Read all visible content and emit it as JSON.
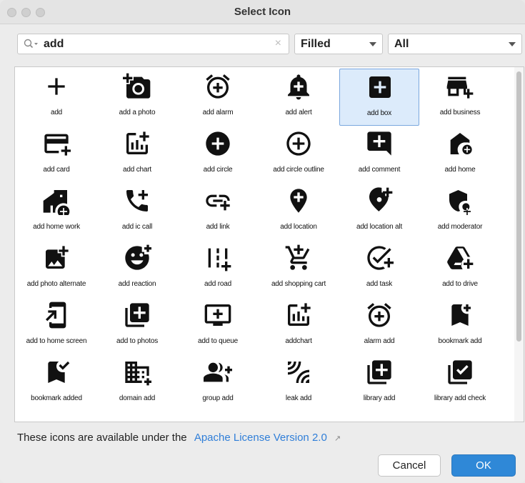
{
  "window": {
    "title": "Select Icon"
  },
  "search": {
    "value": "add",
    "clear_glyph": "×"
  },
  "filters": {
    "style_selected": "Filled",
    "category_selected": "All"
  },
  "icons": [
    {
      "label": "add",
      "icon": "add-icon"
    },
    {
      "label": "add a photo",
      "icon": "add-a-photo-icon"
    },
    {
      "label": "add alarm",
      "icon": "add-alarm-icon"
    },
    {
      "label": "add alert",
      "icon": "add-alert-icon"
    },
    {
      "label": "add box",
      "icon": "add-box-icon",
      "selected": true
    },
    {
      "label": "add business",
      "icon": "add-business-icon"
    },
    {
      "label": "add card",
      "icon": "add-card-icon"
    },
    {
      "label": "add chart",
      "icon": "add-chart-icon"
    },
    {
      "label": "add circle",
      "icon": "add-circle-icon"
    },
    {
      "label": "add circle outline",
      "icon": "add-circle-outline-icon"
    },
    {
      "label": "add comment",
      "icon": "add-comment-icon"
    },
    {
      "label": "add home",
      "icon": "add-home-icon"
    },
    {
      "label": "add home work",
      "icon": "add-home-work-icon"
    },
    {
      "label": "add ic call",
      "icon": "add-ic-call-icon"
    },
    {
      "label": "add link",
      "icon": "add-link-icon"
    },
    {
      "label": "add location",
      "icon": "add-location-icon"
    },
    {
      "label": "add location alt",
      "icon": "add-location-alt-icon"
    },
    {
      "label": "add moderator",
      "icon": "add-moderator-icon"
    },
    {
      "label": "add photo alternate",
      "icon": "add-photo-alternate-icon"
    },
    {
      "label": "add reaction",
      "icon": "add-reaction-icon"
    },
    {
      "label": "add road",
      "icon": "add-road-icon"
    },
    {
      "label": "add shopping cart",
      "icon": "add-shopping-cart-icon"
    },
    {
      "label": "add task",
      "icon": "add-task-icon"
    },
    {
      "label": "add to drive",
      "icon": "add-to-drive-icon"
    },
    {
      "label": "add to home screen",
      "icon": "add-to-home-screen-icon"
    },
    {
      "label": "add to photos",
      "icon": "add-to-photos-icon"
    },
    {
      "label": "add to queue",
      "icon": "add-to-queue-icon"
    },
    {
      "label": "addchart",
      "icon": "addchart-icon"
    },
    {
      "label": "alarm add",
      "icon": "alarm-add-icon"
    },
    {
      "label": "bookmark add",
      "icon": "bookmark-add-icon"
    },
    {
      "label": "bookmark added",
      "icon": "bookmark-added-icon"
    },
    {
      "label": "domain add",
      "icon": "domain-add-icon"
    },
    {
      "label": "group add",
      "icon": "group-add-icon"
    },
    {
      "label": "leak add",
      "icon": "leak-add-icon"
    },
    {
      "label": "library add",
      "icon": "library-add-icon"
    },
    {
      "label": "library add check",
      "icon": "library-add-check-icon"
    }
  ],
  "footer": {
    "license_text": "These icons are available under the",
    "license_link": "Apache License Version 2.0",
    "external_glyph": "↗"
  },
  "buttons": {
    "cancel": "Cancel",
    "ok": "OK"
  },
  "colors": {
    "accent": "#2f88d7",
    "link": "#2f7ed8",
    "selection_bg": "#dcebfb",
    "selection_border": "#7aa7de"
  }
}
